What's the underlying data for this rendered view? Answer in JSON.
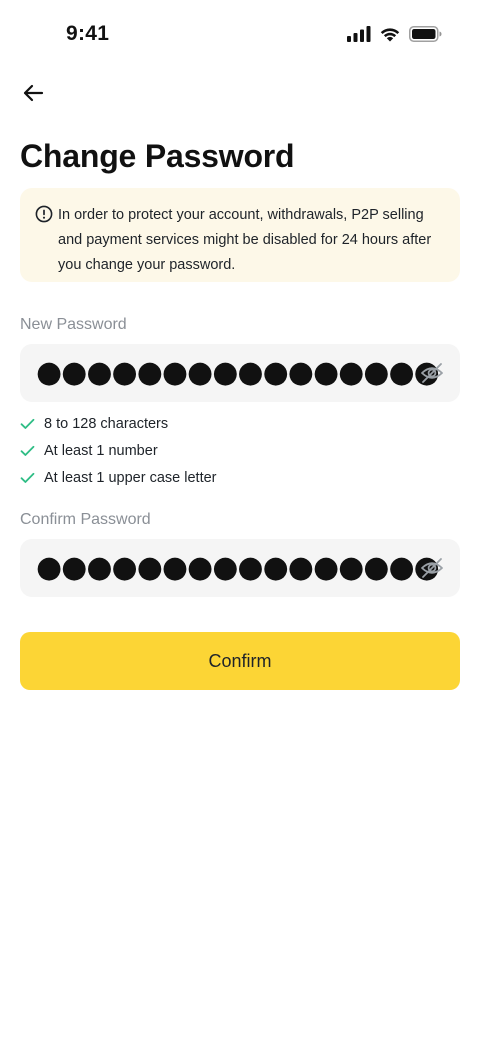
{
  "status_bar": {
    "time": "9:41"
  },
  "header": {
    "title": "Change Password"
  },
  "notice": {
    "text": "In order to protect your account, withdrawals, P2P selling and payment services might be disabled for 24 hours after you change your password."
  },
  "new_password": {
    "label": "New Password",
    "value": "●●●●●●●●●●●●●●●●"
  },
  "rules": [
    {
      "text": "8 to 128 characters",
      "satisfied": true
    },
    {
      "text": "At least 1 number",
      "satisfied": true
    },
    {
      "text": "At least 1 upper case letter",
      "satisfied": true
    }
  ],
  "confirm_password": {
    "label": "Confirm Password",
    "value": "●●●●●●●●●●●●●●●●"
  },
  "actions": {
    "confirm_label": "Confirm"
  },
  "colors": {
    "accent": "#FCD535",
    "notice_bg": "#FDF8E8",
    "check": "#2EBD85",
    "field_bg": "#F5F5F5"
  },
  "icons": {
    "back": "arrow-left-icon",
    "notice": "info-circle-icon",
    "toggle": "eye-off-icon",
    "rule": "check-icon"
  }
}
